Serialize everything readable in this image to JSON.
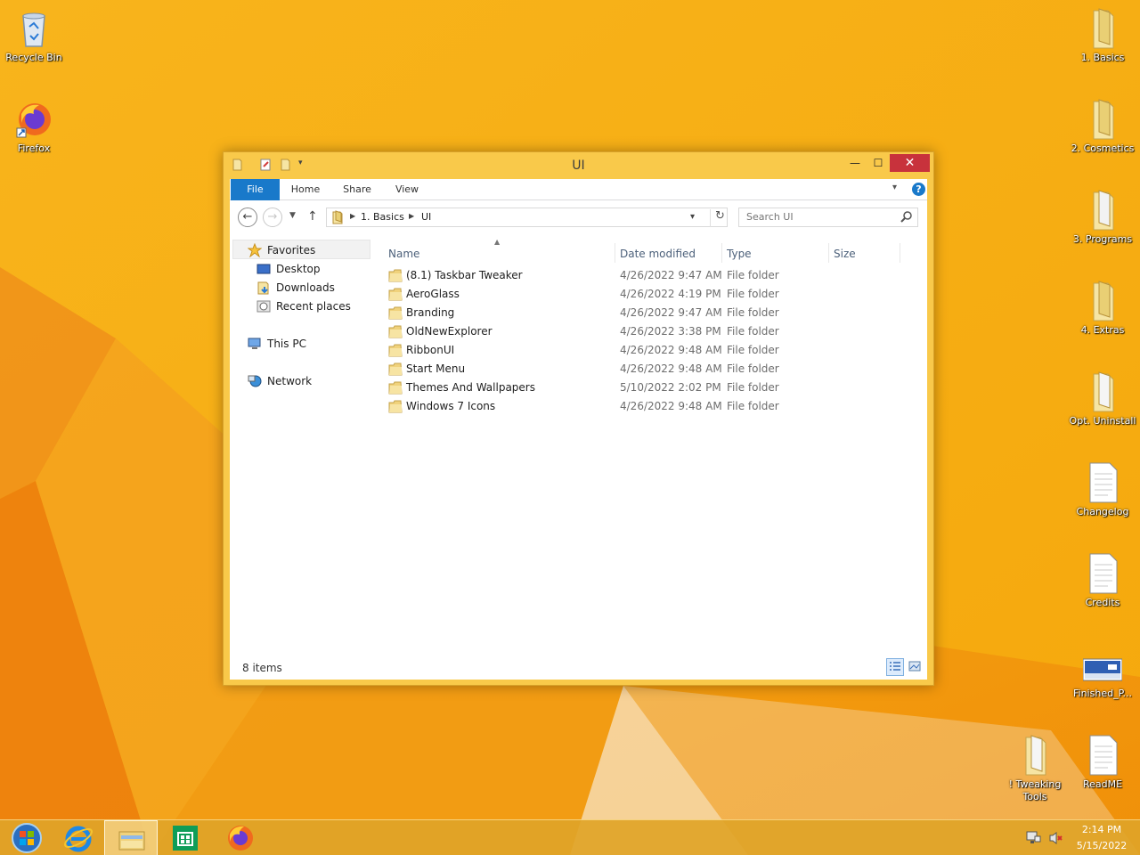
{
  "colors": {
    "wallpaper": "#f6ad12",
    "window_frame": "#f9c94a",
    "file_tab": "#1979ca",
    "close_button": "#c8323c",
    "taskbar": "#e0a428"
  },
  "desktop_left": [
    {
      "label": "Recycle Bin",
      "icon": "recycle-bin-icon"
    },
    {
      "label": "Firefox",
      "icon": "firefox-icon"
    }
  ],
  "desktop_right": [
    {
      "label": "1. Basics",
      "icon": "folder-icon"
    },
    {
      "label": "2. Cosmetics",
      "icon": "folder-icon"
    },
    {
      "label": "3. Programs",
      "icon": "folder-icon"
    },
    {
      "label": "4. Extras",
      "icon": "folder-icon"
    },
    {
      "label": "Opt. Uninstall",
      "icon": "folder-icon"
    },
    {
      "label": "Changelog",
      "icon": "document-icon"
    },
    {
      "label": "Credits",
      "icon": "document-icon"
    },
    {
      "label": "Finished_P...",
      "icon": "image-icon"
    },
    {
      "label": "! Tweaking Tools",
      "icon": "folder-icon"
    },
    {
      "label": "ReadME",
      "icon": "document-icon"
    }
  ],
  "window": {
    "title": "UI",
    "min_glyph": "—",
    "max_glyph": "☐",
    "close_glyph": "✕"
  },
  "ribbon": {
    "tabs": [
      "File",
      "Home",
      "Share",
      "View"
    ]
  },
  "address": {
    "crumbs": [
      "1. Basics",
      "UI"
    ]
  },
  "search": {
    "placeholder": "Search UI"
  },
  "navpane": {
    "favorites": "Favorites",
    "desktop": "Desktop",
    "downloads": "Downloads",
    "recent_places": "Recent places",
    "this_pc": "This PC",
    "network": "Network"
  },
  "columns": {
    "name": "Name",
    "date": "Date modified",
    "type": "Type",
    "size": "Size"
  },
  "files": [
    {
      "name": "(8.1) Taskbar Tweaker",
      "date": "4/26/2022 9:47 AM",
      "type": "File folder"
    },
    {
      "name": "AeroGlass",
      "date": "4/26/2022 4:19 PM",
      "type": "File folder"
    },
    {
      "name": "Branding",
      "date": "4/26/2022 9:47 AM",
      "type": "File folder"
    },
    {
      "name": "OldNewExplorer",
      "date": "4/26/2022 3:38 PM",
      "type": "File folder"
    },
    {
      "name": "RibbonUI",
      "date": "4/26/2022 9:48 AM",
      "type": "File folder"
    },
    {
      "name": "Start Menu",
      "date": "4/26/2022 9:48 AM",
      "type": "File folder"
    },
    {
      "name": "Themes And Wallpapers",
      "date": "5/10/2022 2:02 PM",
      "type": "File folder"
    },
    {
      "name": "Windows 7 Icons",
      "date": "4/26/2022 9:48 AM",
      "type": "File folder"
    }
  ],
  "status": {
    "count": "8 items"
  },
  "taskbar": {
    "time": "2:14 PM",
    "date": "5/15/2022"
  }
}
